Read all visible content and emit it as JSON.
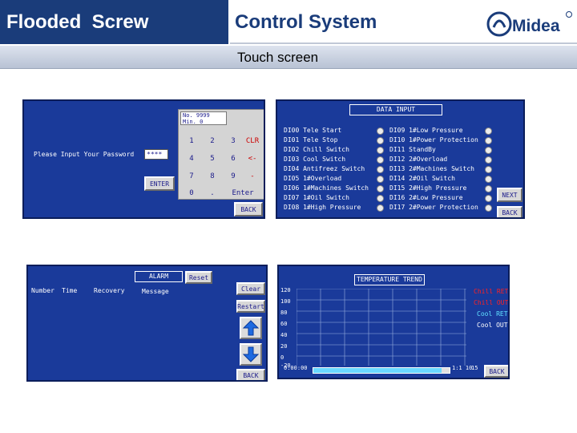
{
  "header": {
    "left_title": "Flooded  Screw",
    "right_title": "Control System",
    "logo_text": "Midea",
    "subtitle": "Touch screen"
  },
  "password_panel": {
    "prompt": "Please Input Your Password",
    "field_value": "****",
    "enter_button": "ENTER",
    "back_button": "BACK",
    "keypad": {
      "display_line1": "No. 9999",
      "display_line2": "Min. 0",
      "keys": [
        [
          "1",
          "2",
          "3",
          "CLR"
        ],
        [
          "4",
          "5",
          "6",
          "<-"
        ],
        [
          "7",
          "8",
          "9",
          "-"
        ],
        [
          "0",
          ".",
          "Enter"
        ]
      ]
    }
  },
  "data_input_panel": {
    "title": "DATA INPUT",
    "left_rows": [
      "DI00 Tele Start",
      "DI01 Tele Stop",
      "DI02 Chill Switch",
      "DI03 Cool Switch",
      "DI04 Antifreez Switch",
      "DI05 1#Overload",
      "DI06 1#Machines Switch",
      "DI07 1#Oil  Switch",
      "DI08 1#High Pressure"
    ],
    "right_rows": [
      "DI09 1#Low Pressure",
      "DI10 1#Power Protection",
      "DI11 StandBy",
      "DI12 2#Overload",
      "DI13 2#Machines Switch",
      "DI14 2#Oil Switch",
      "DI15 2#High Pressure",
      "DI16 2#Low Pressure",
      "DI17 2#Power Protection"
    ],
    "next_button": "NEXT",
    "back_button": "BACK"
  },
  "alarm_panel": {
    "title": "ALARM",
    "reset_button": "Reset",
    "columns": [
      "Number",
      "Time",
      "Recovery",
      "Message"
    ],
    "clear_button": "Clear",
    "restart_button": "Restart",
    "up_icon": "arrow-up-icon",
    "down_icon": "arrow-down-icon",
    "back_button": "BACK"
  },
  "trend_panel": {
    "title": "TEMPERATURE TREND",
    "y_ticks": [
      "120",
      "100",
      "80",
      "60",
      "40",
      "20",
      "0",
      "-20"
    ],
    "x_start": "0:00:00",
    "x_end": "1:1 10",
    "scroll_value": "15",
    "legend": [
      {
        "label": "Chill RET",
        "color": "#ff2020"
      },
      {
        "label": "Chill OUT",
        "color": "#ff2020"
      },
      {
        "label": "Cool RET",
        "color": "#60e0ff"
      },
      {
        "label": "Cool OUT",
        "color": "#ffffff"
      }
    ],
    "back_button": "BACK"
  },
  "colors": {
    "header_blue": "#1a3c7a",
    "panel_blue": "#1a3a9a"
  }
}
